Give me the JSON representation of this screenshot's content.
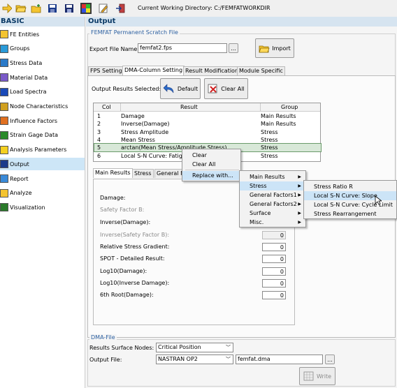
{
  "toolbar": {
    "icons": [
      "arrow-right-icon",
      "open-folder-icon",
      "new-folder-icon",
      "save-icon",
      "save-all-icon",
      "color-palette-icon",
      "edit-icon",
      "exit-icon"
    ],
    "cwd": "Current Working Directory: C:/FEMFATWORKDIR"
  },
  "sidebar": {
    "title": "BASIC",
    "items": [
      {
        "label": "FE Entities"
      },
      {
        "label": "Groups"
      },
      {
        "label": "Stress Data"
      },
      {
        "label": "Material Data"
      },
      {
        "label": "Load Spectra"
      },
      {
        "label": "Node Characteristics"
      },
      {
        "label": "Influence Factors"
      },
      {
        "label": "Strain Gage Data"
      },
      {
        "label": "Analysis Parameters"
      },
      {
        "label": "Output"
      },
      {
        "label": "Report"
      },
      {
        "label": "Analyze"
      },
      {
        "label": "Visualization"
      }
    ],
    "selected": "Output"
  },
  "output": {
    "title": "Output",
    "scratch_group": "FEMFAT Permanent Scratch File",
    "export_label": "Export File Name:",
    "export_value": "femfat2.fps",
    "browse": "...",
    "import": "Import",
    "tabs": [
      "FPS Setting",
      "DMA-Column Setting",
      "Result Modification",
      "Module Specific"
    ],
    "selected_label": "Output Results Selected:",
    "default_btn": "Default",
    "clear_all_btn": "Clear All",
    "table": {
      "headers": [
        "Col",
        "Result",
        "Group"
      ],
      "rows": [
        {
          "col": "1",
          "result": "Damage",
          "group": "Main Results"
        },
        {
          "col": "2",
          "result": "Inverse(Damage)",
          "group": "Main Results"
        },
        {
          "col": "3",
          "result": "Stress Amplitude",
          "group": "Stress"
        },
        {
          "col": "4",
          "result": "Mean Stress",
          "group": "Stress"
        },
        {
          "col": "5",
          "result": "arctan(Mean Stress/Amplitude Stress)",
          "group": "Stress"
        },
        {
          "col": "6",
          "result": "Local S-N Curve: Fatigue",
          "group": "Stress"
        }
      ]
    },
    "subtabs": [
      "Main Results",
      "Stress",
      "General F"
    ],
    "fields": [
      {
        "label": "Damage:",
        "value": "",
        "disabled": false,
        "has_box": false
      },
      {
        "label": "Safety Factor B:",
        "value": "",
        "disabled": true,
        "has_box": false
      },
      {
        "label": "Inverse(Damage):",
        "value": "",
        "disabled": false,
        "has_box": false
      },
      {
        "label": "Inverse(Safety Factor B):",
        "value": "0",
        "disabled": true,
        "has_box": true
      },
      {
        "label": "Relative Stress Gradient:",
        "value": "0",
        "disabled": false,
        "has_box": true
      },
      {
        "label": "SPOT - Detailed Result:",
        "value": "0",
        "disabled": false,
        "has_box": true
      },
      {
        "label": "Log10(Damage):",
        "value": "0",
        "disabled": false,
        "has_box": true
      },
      {
        "label": "Log10(Inverse Damage):",
        "value": "0",
        "disabled": false,
        "has_box": true
      },
      {
        "label": "6th Root(Damage):",
        "value": "0",
        "disabled": false,
        "has_box": true
      }
    ],
    "dma_group": "DMA-File",
    "surface_label": "Results Surface Nodes:",
    "surface_value": "Critical Position",
    "outfile_label": "Output File:",
    "outfile_format": "NASTRAN OP2",
    "outfile_name": "femfat.dma",
    "write": "Write"
  },
  "context_menu": {
    "items": [
      "Clear",
      "Clear All",
      "Replace with..."
    ],
    "submenu1": [
      {
        "label": "Main Results",
        "has_sub": true
      },
      {
        "label": "Stress",
        "has_sub": true
      },
      {
        "label": "General Factors1",
        "has_sub": true
      },
      {
        "label": "General Factors2",
        "has_sub": true
      },
      {
        "label": "Surface",
        "has_sub": true
      },
      {
        "label": "Misc.",
        "has_sub": true
      }
    ],
    "submenu2": [
      "Stress Ratio R",
      "Local S-N Curve: Slope",
      "Local S-N Curve: Cycle Limit",
      "Stress Rearrangement"
    ]
  },
  "colors": {
    "accent": "#2b5fa0",
    "header_bg": "#d6e4f0",
    "selection": "#cce4f7"
  }
}
